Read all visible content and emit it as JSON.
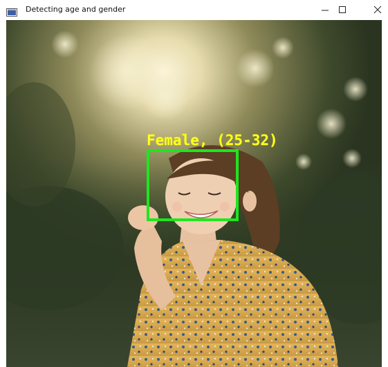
{
  "window": {
    "title": "Detecting age and gender",
    "app_icon": "window-app-icon",
    "controls": {
      "minimize_icon": "minimize-icon",
      "maximize_icon": "maximize-icon",
      "close_icon": "close-icon"
    }
  },
  "detection": {
    "label": "Female, (25-32)",
    "box_color": "#1ee61e",
    "label_color": "#ffff1e"
  }
}
